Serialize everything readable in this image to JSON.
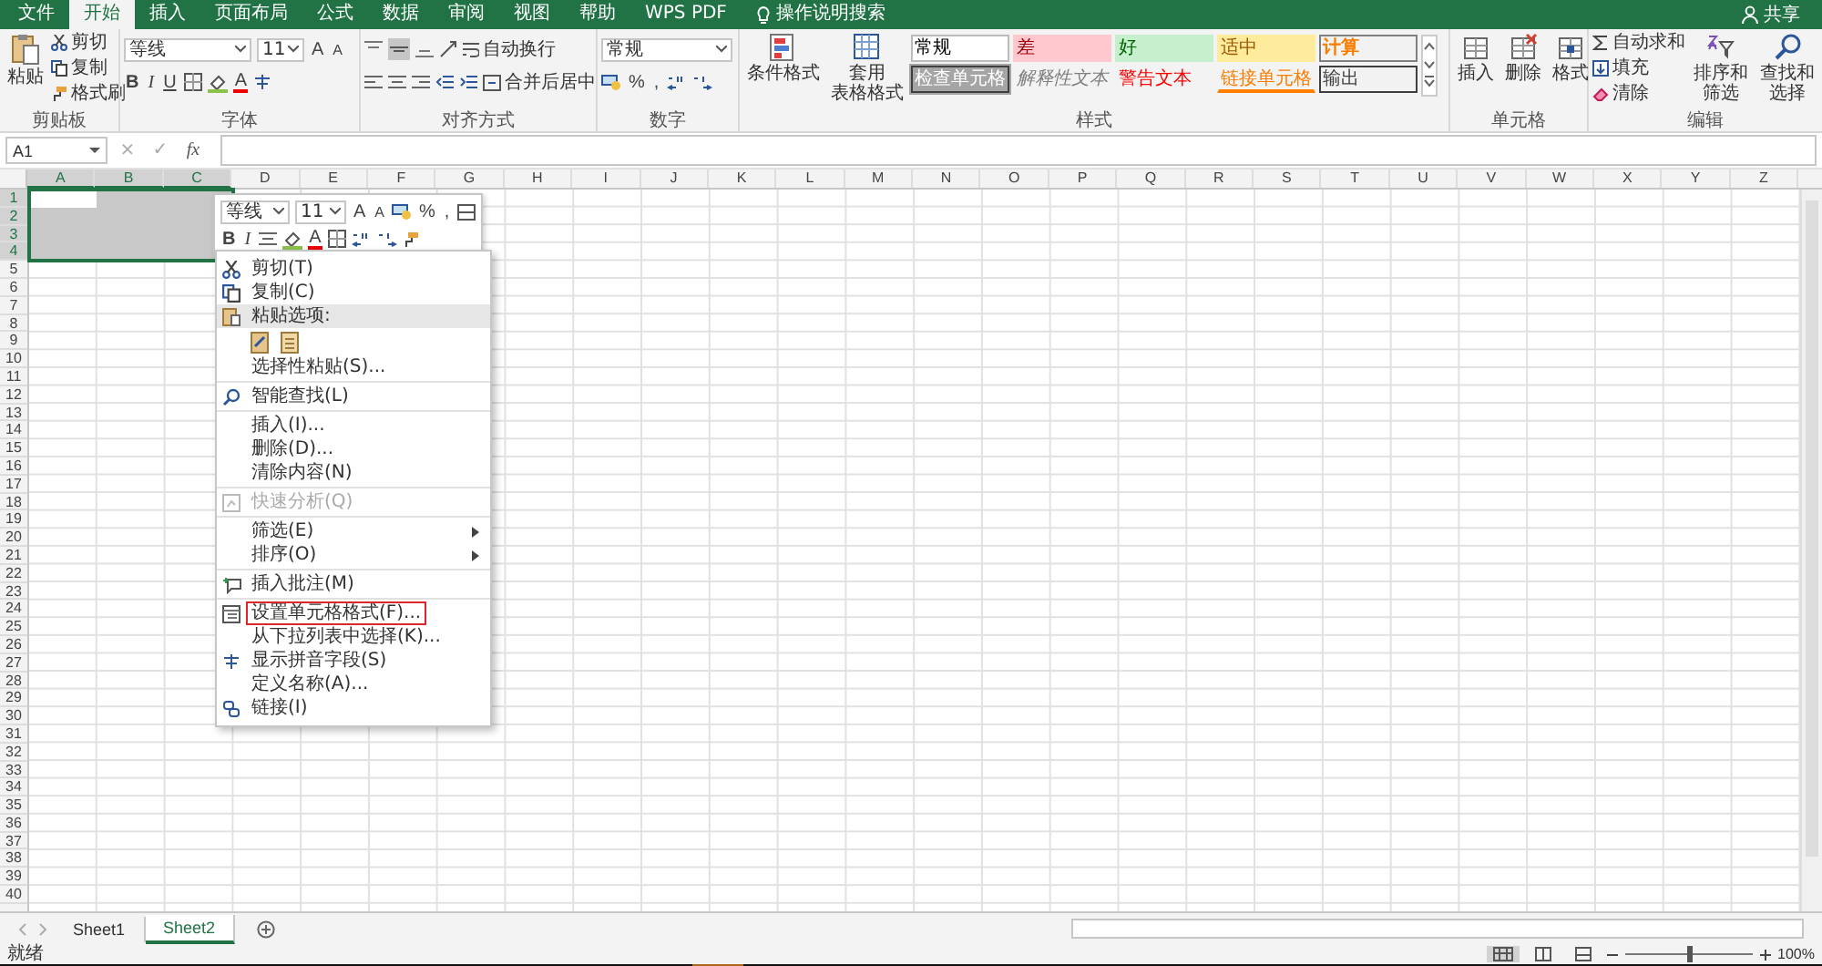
{
  "tabs": [
    {
      "label": "文件",
      "selected": false
    },
    {
      "label": "开始",
      "selected": true
    },
    {
      "label": "插入",
      "selected": false
    },
    {
      "label": "页面布局",
      "selected": false
    },
    {
      "label": "公式",
      "selected": false
    },
    {
      "label": "数据",
      "selected": false
    },
    {
      "label": "审阅",
      "selected": false
    },
    {
      "label": "视图",
      "selected": false
    },
    {
      "label": "帮助",
      "selected": false
    },
    {
      "label": "WPS PDF",
      "selected": false
    }
  ],
  "tell_me": "操作说明搜索",
  "share": "共享",
  "clipboard": {
    "paste": "粘贴",
    "cut": "剪切",
    "copy": "复制",
    "painter": "格式刷",
    "label": "剪贴板"
  },
  "font": {
    "name": "等线",
    "size": "11",
    "grow": "A",
    "shrink": "A",
    "bold": "B",
    "italic": "I",
    "underline": "U",
    "color_letter": "A",
    "label": "字体"
  },
  "alignment": {
    "wrap": "自动换行",
    "merge": "合并后居中",
    "label": "对齐方式"
  },
  "number": {
    "format": "常规",
    "percent": "%",
    "comma": ",",
    "label": "数字"
  },
  "styles": {
    "conditional": "条件格式",
    "table_line1": "套用",
    "table_line2": "表格格式",
    "label": "样式",
    "cells": [
      {
        "text": "常规",
        "kind": "normal"
      },
      {
        "text": "差",
        "kind": "bad"
      },
      {
        "text": "好",
        "kind": "good"
      },
      {
        "text": "适中",
        "kind": "neutral"
      },
      {
        "text": "计算",
        "kind": "calc"
      },
      {
        "text": "检查单元格",
        "kind": "check"
      },
      {
        "text": "解释性文本",
        "kind": "explanatory"
      },
      {
        "text": "警告文本",
        "kind": "warning"
      },
      {
        "text": "链接单元格",
        "kind": "linked"
      },
      {
        "text": "输出",
        "kind": "output"
      }
    ]
  },
  "cells_group": {
    "buttons": [
      "插入",
      "删除",
      "格式"
    ],
    "label": "单元格"
  },
  "editing": {
    "autosum": "自动求和",
    "fill": "填充",
    "clear": "清除",
    "sort": "排序和筛选",
    "find": "查找和选择",
    "label": "编辑"
  },
  "formula_bar": {
    "name_box": "A1",
    "cancel": "×",
    "enter": "✓",
    "fx": "fx"
  },
  "columns": [
    {
      "label": "A",
      "selected": true
    },
    {
      "label": "B",
      "selected": true
    },
    {
      "label": "C",
      "selected": true
    },
    {
      "label": "D",
      "selected": false
    },
    {
      "label": "E",
      "selected": false
    },
    {
      "label": "F",
      "selected": false
    },
    {
      "label": "G",
      "selected": false
    },
    {
      "label": "H",
      "selected": false
    },
    {
      "label": "I",
      "selected": false
    },
    {
      "label": "J",
      "selected": false
    },
    {
      "label": "K",
      "selected": false
    },
    {
      "label": "L",
      "selected": false
    },
    {
      "label": "M",
      "selected": false
    },
    {
      "label": "N",
      "selected": false
    },
    {
      "label": "O",
      "selected": false
    },
    {
      "label": "P",
      "selected": false
    },
    {
      "label": "Q",
      "selected": false
    },
    {
      "label": "R",
      "selected": false
    },
    {
      "label": "S",
      "selected": false
    },
    {
      "label": "T",
      "selected": false
    },
    {
      "label": "U",
      "selected": false
    },
    {
      "label": "V",
      "selected": false
    },
    {
      "label": "W",
      "selected": false
    },
    {
      "label": "X",
      "selected": false
    },
    {
      "label": "Y",
      "selected": false
    },
    {
      "label": "Z",
      "selected": false
    }
  ],
  "rows": [
    {
      "label": "1",
      "selected": true
    },
    {
      "label": "2",
      "selected": true
    },
    {
      "label": "3",
      "selected": true
    },
    {
      "label": "4",
      "selected": true
    },
    {
      "label": "5",
      "selected": false
    },
    {
      "label": "6",
      "selected": false
    },
    {
      "label": "7",
      "selected": false
    },
    {
      "label": "8",
      "selected": false
    },
    {
      "label": "9",
      "selected": false
    },
    {
      "label": "10",
      "selected": false
    },
    {
      "label": "11",
      "selected": false
    },
    {
      "label": "12",
      "selected": false
    },
    {
      "label": "13",
      "selected": false
    },
    {
      "label": "14",
      "selected": false
    },
    {
      "label": "15",
      "selected": false
    },
    {
      "label": "16",
      "selected": false
    },
    {
      "label": "17",
      "selected": false
    },
    {
      "label": "18",
      "selected": false
    },
    {
      "label": "19",
      "selected": false
    },
    {
      "label": "20",
      "selected": false
    },
    {
      "label": "21",
      "selected": false
    },
    {
      "label": "22",
      "selected": false
    },
    {
      "label": "23",
      "selected": false
    },
    {
      "label": "24",
      "selected": false
    },
    {
      "label": "25",
      "selected": false
    },
    {
      "label": "26",
      "selected": false
    },
    {
      "label": "27",
      "selected": false
    },
    {
      "label": "28",
      "selected": false
    },
    {
      "label": "29",
      "selected": false
    },
    {
      "label": "30",
      "selected": false
    },
    {
      "label": "31",
      "selected": false
    },
    {
      "label": "32",
      "selected": false
    },
    {
      "label": "33",
      "selected": false
    },
    {
      "label": "34",
      "selected": false
    },
    {
      "label": "35",
      "selected": false
    },
    {
      "label": "36",
      "selected": false
    },
    {
      "label": "37",
      "selected": false
    },
    {
      "label": "38",
      "selected": false
    },
    {
      "label": "39",
      "selected": false
    },
    {
      "label": "40",
      "selected": false
    }
  ],
  "mini_toolbar": {
    "font": "等线",
    "size": "11",
    "grow": "A",
    "shrink": "A",
    "percent": "%",
    "comma": ",",
    "bold": "B",
    "italic": "I",
    "color_letter": "A"
  },
  "context_menu": {
    "sections": [
      [
        {
          "kind": "cut",
          "label": "剪切(T)",
          "disabled": false,
          "submenu": false,
          "highlighted": false
        },
        {
          "kind": "copy",
          "label": "复制(C)",
          "disabled": false,
          "submenu": false,
          "highlighted": false
        },
        {
          "kind": "paste_header",
          "label": "粘贴选项:",
          "disabled": false,
          "submenu": false,
          "highlighted": false
        },
        {
          "kind": "paste_options"
        },
        {
          "kind": "item",
          "label": "选择性粘贴(S)...",
          "disabled": false,
          "submenu": false,
          "highlighted": false
        }
      ],
      [
        {
          "kind": "search",
          "label": "智能查找(L)",
          "disabled": false,
          "submenu": false,
          "highlighted": false
        }
      ],
      [
        {
          "kind": "item",
          "label": "插入(I)...",
          "disabled": false,
          "submenu": false,
          "highlighted": false
        },
        {
          "kind": "item",
          "label": "删除(D)...",
          "disabled": false,
          "submenu": false,
          "highlighted": false
        },
        {
          "kind": "item",
          "label": "清除内容(N)",
          "disabled": false,
          "submenu": false,
          "highlighted": false
        }
      ],
      [
        {
          "kind": "analysis",
          "label": "快速分析(Q)",
          "disabled": true,
          "submenu": false,
          "highlighted": false
        }
      ],
      [
        {
          "kind": "item",
          "label": "筛选(E)",
          "disabled": false,
          "submenu": true,
          "highlighted": false
        },
        {
          "kind": "item",
          "label": "排序(O)",
          "disabled": false,
          "submenu": true,
          "highlighted": false
        }
      ],
      [
        {
          "kind": "comment",
          "label": "插入批注(M)",
          "disabled": false,
          "submenu": false,
          "highlighted": false
        }
      ],
      [
        {
          "kind": "format",
          "label": "设置单元格格式(F)...",
          "disabled": false,
          "submenu": false,
          "highlighted": true
        },
        {
          "kind": "item",
          "label": "从下拉列表中选择(K)...",
          "disabled": false,
          "submenu": false,
          "highlighted": false
        },
        {
          "kind": "pinyin",
          "label": "显示拼音字段(S)",
          "disabled": false,
          "submenu": false,
          "highlighted": false
        },
        {
          "kind": "item",
          "label": "定义名称(A)...",
          "disabled": false,
          "submenu": false,
          "highlighted": false
        },
        {
          "kind": "link",
          "label": "链接(I)",
          "disabled": false,
          "submenu": false,
          "highlighted": false
        }
      ]
    ]
  },
  "sheets": [
    {
      "label": "Sheet1",
      "selected": false
    },
    {
      "label": "Sheet2",
      "selected": true
    }
  ],
  "status": "就绪",
  "zoom": "100%",
  "zoom_slider": {
    "level": 0.5
  }
}
